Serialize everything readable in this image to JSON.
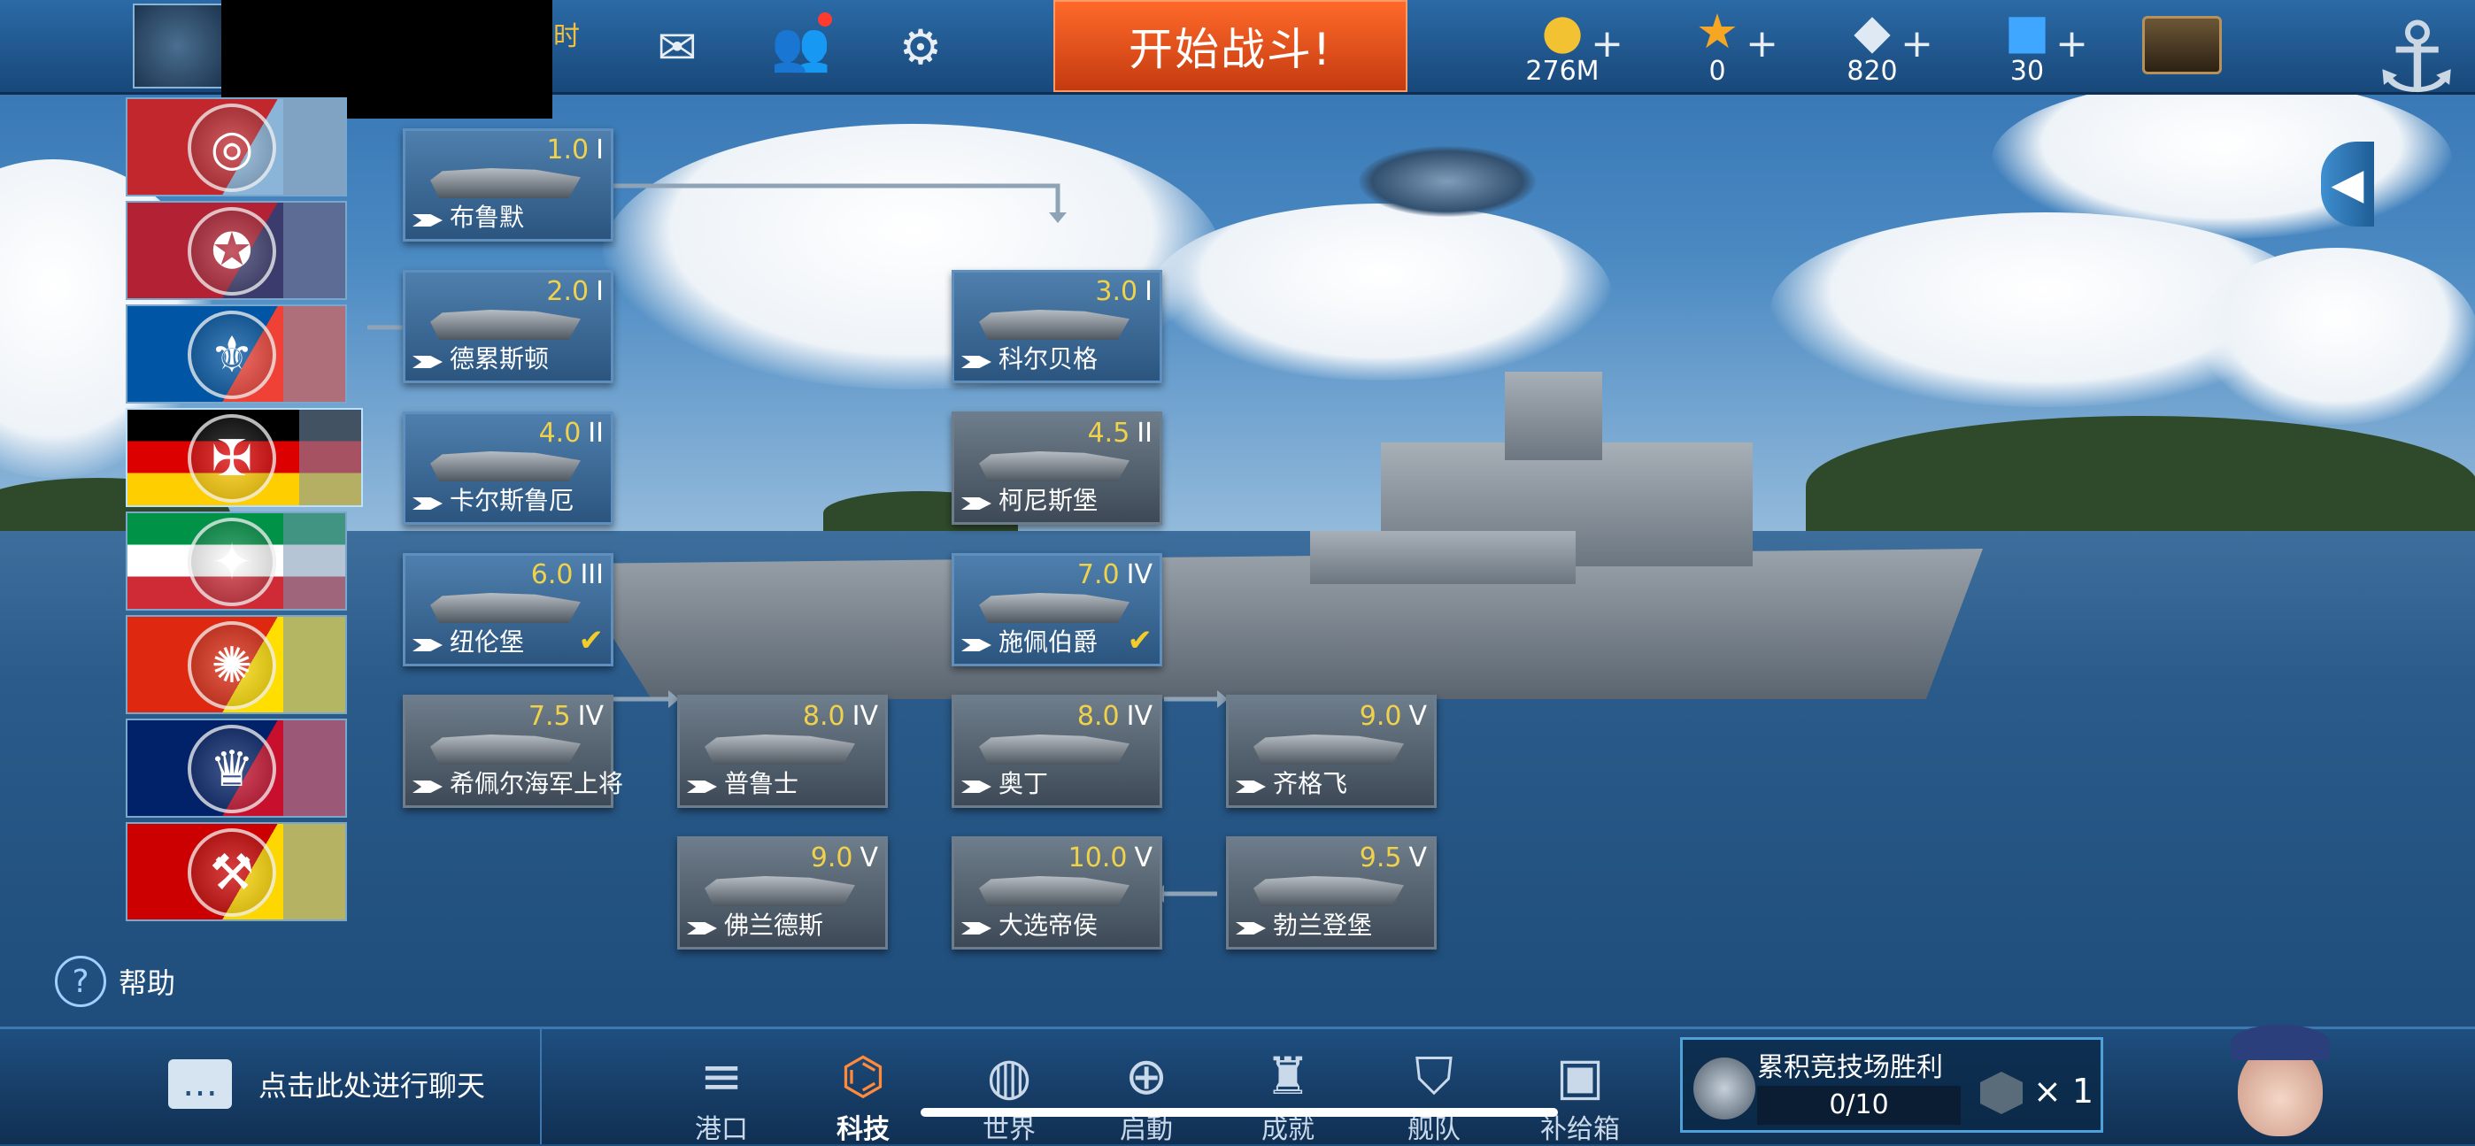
{
  "topbar": {
    "vip_label": "小时",
    "battle_button": "开始战斗!",
    "resources": [
      {
        "name": "gold",
        "icon": "gold-coin-icon",
        "value": "276M"
      },
      {
        "name": "star",
        "icon": "star-icon",
        "value": "0"
      },
      {
        "name": "diamond",
        "icon": "diamond-icon",
        "value": "820"
      },
      {
        "name": "cube",
        "icon": "blue-cube-icon",
        "value": "30"
      }
    ],
    "plus": "+"
  },
  "nations": [
    {
      "id": "nation-1",
      "flag_colors": [
        "#c1272d",
        "#8ab4d8"
      ],
      "emblem": "◎"
    },
    {
      "id": "nation-usa",
      "flag_colors": [
        "#b22234",
        "#3c3b6e"
      ],
      "emblem": "✪"
    },
    {
      "id": "nation-france",
      "flag_colors": [
        "#0055a4",
        "#ef4135"
      ],
      "emblem": "⚜"
    },
    {
      "id": "nation-germany",
      "flag_colors": [
        "#000000",
        "#dd0000",
        "#ffce00"
      ],
      "emblem": "✠",
      "selected": true
    },
    {
      "id": "nation-italy",
      "flag_colors": [
        "#009246",
        "#ffffff",
        "#ce2b37"
      ],
      "emblem": "✦"
    },
    {
      "id": "nation-china",
      "flag_colors": [
        "#de2910",
        "#ffde00"
      ],
      "emblem": "✺"
    },
    {
      "id": "nation-uk",
      "flag_colors": [
        "#012169",
        "#c8102e"
      ],
      "emblem": "♛"
    },
    {
      "id": "nation-ussr",
      "flag_colors": [
        "#cc0000",
        "#ffd700"
      ],
      "emblem": "⚒"
    }
  ],
  "tech_tree": [
    {
      "id": "n1",
      "name": "布鲁默",
      "tier": "1.0",
      "roman": "I",
      "researched": true,
      "check": false
    },
    {
      "id": "n2",
      "name": "德累斯顿",
      "tier": "2.0",
      "roman": "I",
      "researched": true,
      "check": false
    },
    {
      "id": "n3",
      "name": "卡尔斯鲁厄",
      "tier": "4.0",
      "roman": "II",
      "researched": true,
      "check": false
    },
    {
      "id": "n4",
      "name": "纽伦堡",
      "tier": "6.0",
      "roman": "III",
      "researched": true,
      "check": true
    },
    {
      "id": "n5",
      "name": "希佩尔海军上将",
      "tier": "7.5",
      "roman": "IV",
      "researched": false,
      "check": false
    },
    {
      "id": "n6",
      "name": "科尔贝格",
      "tier": "3.0",
      "roman": "I",
      "researched": true,
      "check": false
    },
    {
      "id": "n7",
      "name": "柯尼斯堡",
      "tier": "4.5",
      "roman": "II",
      "researched": false,
      "check": false
    },
    {
      "id": "n8",
      "name": "施佩伯爵",
      "tier": "7.0",
      "roman": "IV",
      "researched": true,
      "check": true
    },
    {
      "id": "n9",
      "name": "普鲁士",
      "tier": "8.0",
      "roman": "IV",
      "researched": false,
      "check": false
    },
    {
      "id": "n10",
      "name": "奥丁",
      "tier": "8.0",
      "roman": "IV",
      "researched": false,
      "check": false
    },
    {
      "id": "n11",
      "name": "齐格飞",
      "tier": "9.0",
      "roman": "V",
      "researched": false,
      "check": false
    },
    {
      "id": "n12",
      "name": "佛兰德斯",
      "tier": "9.0",
      "roman": "V",
      "researched": false,
      "check": false
    },
    {
      "id": "n13",
      "name": "大选帝侯",
      "tier": "10.0",
      "roman": "V",
      "researched": false,
      "check": false
    },
    {
      "id": "n14",
      "name": "勃兰登堡",
      "tier": "9.5",
      "roman": "V",
      "researched": false,
      "check": false
    }
  ],
  "help_label": "帮助",
  "chat_label": "点击此处进行聊天",
  "nav": [
    {
      "id": "harbor",
      "label": "港口",
      "icon": "harbor-icon",
      "active": false
    },
    {
      "id": "tech",
      "label": "科技",
      "icon": "tech-icon",
      "active": true
    },
    {
      "id": "world",
      "label": "世界",
      "icon": "globe-icon",
      "active": false
    },
    {
      "id": "launch",
      "label": "启動",
      "icon": "launch-icon",
      "active": false
    },
    {
      "id": "achievement",
      "label": "成就",
      "icon": "wings-icon",
      "active": false
    },
    {
      "id": "fleet",
      "label": "舰队",
      "icon": "shield-icon",
      "active": false
    },
    {
      "id": "supply",
      "label": "补给箱",
      "icon": "supply-box-icon",
      "active": false
    }
  ],
  "arena": {
    "title": "累积竞技场胜利",
    "progress": "0/10",
    "progress_fraction": 0.0,
    "multiplier": "× 1"
  }
}
